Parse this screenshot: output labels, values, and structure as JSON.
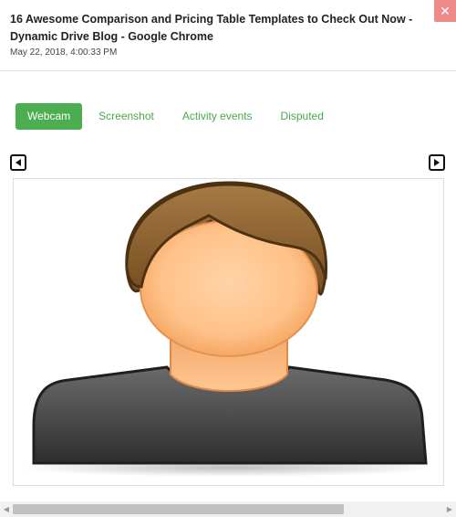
{
  "dialog": {
    "title": "16 Awesome Comparison and Pricing Table Templates to Check Out Now - Dynamic Drive Blog - Google Chrome",
    "timestamp": "May 22, 2018, 4:00:33 PM",
    "close_icon": "close-icon"
  },
  "tabs": [
    {
      "label": "Webcam",
      "active": true
    },
    {
      "label": "Screenshot",
      "active": false
    },
    {
      "label": "Activity events",
      "active": false
    },
    {
      "label": "Disputed",
      "active": false
    }
  ],
  "navigation": {
    "prev_icon": "triangle-left-icon",
    "next_icon": "triangle-right-icon"
  },
  "viewer": {
    "image": "default-avatar-placeholder"
  },
  "colors": {
    "accent": "#4cae50",
    "close": "#ee8a8a",
    "hair": "#8b5a2b",
    "skin": "#ffc48f",
    "shirt": "#555555"
  }
}
